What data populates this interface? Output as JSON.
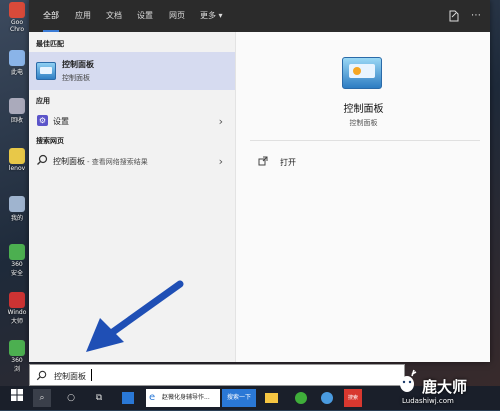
{
  "desktop_icons": [
    {
      "label": "Goo\nChro",
      "color": "#d84a3a"
    },
    {
      "label": "此电",
      "color": "#8ab4e8"
    },
    {
      "label": "回收",
      "color": "#aab"
    },
    {
      "label": "lenov",
      "color": "#e8c848"
    },
    {
      "label": "我的",
      "color": "#9fb4cf"
    },
    {
      "label": "360\n安全",
      "color": "#4caf50"
    },
    {
      "label": "Windo\n大师",
      "color": "#c33"
    },
    {
      "label": "360\n浏",
      "color": "#4caf50"
    }
  ],
  "tabs": [
    "全部",
    "应用",
    "文档",
    "设置",
    "网页",
    "更多 ▾"
  ],
  "left": {
    "best_match_header": "最佳匹配",
    "best_match": {
      "title": "控制面板",
      "subtitle": "控制面板"
    },
    "apps_header": "应用",
    "apps": [
      {
        "label": "设置"
      }
    ],
    "web_header": "搜索网页",
    "web": {
      "query": "控制面板",
      "suffix": " - 查看网络搜索结果"
    }
  },
  "right": {
    "title": "控制面板",
    "subtitle": "控制面板",
    "actions": [
      {
        "label": "打开"
      }
    ]
  },
  "search": {
    "value": "控制面板"
  },
  "taskbar": {
    "browser_tab": "赵薇化身辅导作...",
    "search_btn": "搜索一下",
    "app_badge": "搜索"
  },
  "watermark": {
    "brand": "鹿大师",
    "site": "Ludashiwj.com"
  },
  "colors": {
    "accent": "#3a7bd5",
    "best_match_bg": "#d6dbf0",
    "arrow": "#1f4fb5"
  }
}
